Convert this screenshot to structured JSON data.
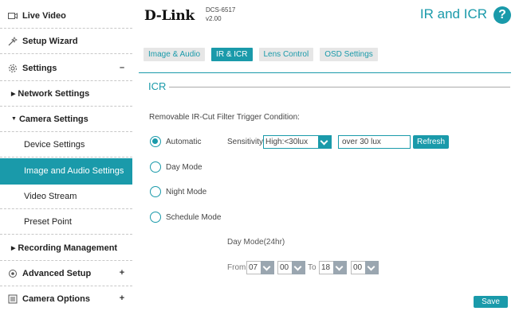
{
  "sidebar": {
    "items": [
      {
        "label": "Live Video",
        "icon": "video-icon"
      },
      {
        "label": "Setup Wizard",
        "icon": "wand-icon"
      },
      {
        "label": "Settings",
        "icon": "gear-icon",
        "toggle": "–"
      },
      {
        "label": "Network Settings",
        "arrow": "▶"
      },
      {
        "label": "Camera Settings",
        "arrow": "▼"
      },
      {
        "label": "Device Settings"
      },
      {
        "label": "Image and Audio Settings"
      },
      {
        "label": "Video Stream"
      },
      {
        "label": "Preset Point"
      },
      {
        "label": "Recording Management",
        "arrow": "▶"
      },
      {
        "label": "Advanced Setup",
        "icon": "advanced-icon",
        "toggle": "+"
      },
      {
        "label": "Camera Options",
        "icon": "options-icon",
        "toggle": "+"
      }
    ]
  },
  "header": {
    "logo": "D-Link",
    "model": "DCS-6517",
    "version": "v2.00",
    "title": "IR and ICR",
    "help": "?"
  },
  "tabs": [
    {
      "label": "Image & Audio"
    },
    {
      "label": "IR & ICR"
    },
    {
      "label": "Lens Control"
    },
    {
      "label": "OSD Settings"
    }
  ],
  "icr": {
    "section_title": "ICR",
    "condition_label": "Removable IR-Cut Filter Trigger Condition:",
    "modes": [
      "Automatic",
      "Day Mode",
      "Night Mode",
      "Schedule Mode"
    ],
    "selected_mode": "Automatic",
    "sensitivity_label": "Sensitivity",
    "sensitivity_value": "High:<30lux",
    "lux_text": "over 30 lux",
    "refresh_label": "Refresh",
    "daymode_label": "Day Mode(24hr)",
    "from_label": "From",
    "to_label": "To",
    "from_hour": "07",
    "from_min": "00",
    "to_hour": "18",
    "to_min": "00"
  },
  "save_label": "Save",
  "colors": {
    "accent": "#1a9aaa"
  }
}
